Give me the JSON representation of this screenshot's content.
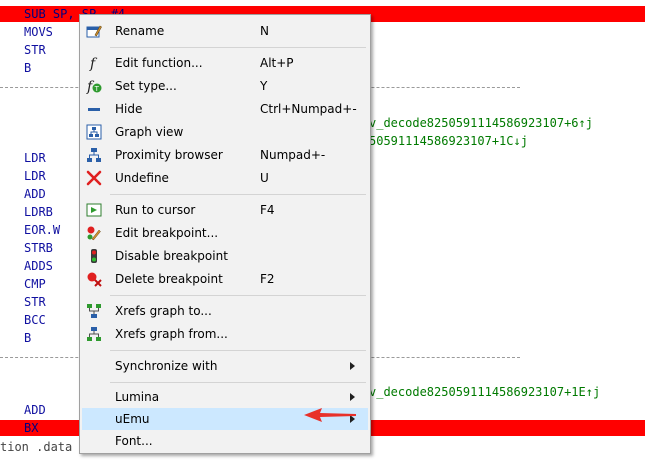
{
  "disasm": {
    "top_line": "SUB  SP, SP, #4",
    "mnemonics_a": [
      "MOVS",
      "STR",
      "B"
    ],
    "mnemonics_b": [
      "LDR",
      "LDR",
      "ADD",
      "LDRB",
      "EOR.W",
      "STRB",
      "ADDS",
      "CMP",
      "STR",
      "BCC",
      "B"
    ],
    "mnemonics_c": [
      "ADD",
      "BX"
    ],
    "xref_1": "v_decode8250591114586923107+6↑j",
    "xref_2": "50591114586923107+1C↓j",
    "xref_3": "v_decode8250591114586923107+1E↑j",
    "status": "tion .data"
  },
  "menu": {
    "items": [
      {
        "label": "Rename",
        "shortcut": "N",
        "icon": "rename-icon"
      },
      {
        "label": "Edit function...",
        "shortcut": "Alt+P",
        "icon": "function-icon"
      },
      {
        "label": "Set type...",
        "shortcut": "Y",
        "icon": "set-type-icon"
      },
      {
        "label": "Hide",
        "shortcut": "Ctrl+Numpad+-",
        "icon": "hide-icon"
      },
      {
        "label": "Graph view",
        "shortcut": "",
        "icon": "graph-view-icon"
      },
      {
        "label": "Proximity browser",
        "shortcut": "Numpad+-",
        "icon": "proximity-icon"
      },
      {
        "label": "Undefine",
        "shortcut": "U",
        "icon": "undefine-icon"
      },
      {
        "label": "Run to cursor",
        "shortcut": "F4",
        "icon": "run-to-cursor-icon"
      },
      {
        "label": "Edit breakpoint...",
        "shortcut": "",
        "icon": "edit-breakpoint-icon"
      },
      {
        "label": "Disable breakpoint",
        "shortcut": "",
        "icon": "disable-breakpoint-icon"
      },
      {
        "label": "Delete breakpoint",
        "shortcut": "F2",
        "icon": "delete-breakpoint-icon"
      },
      {
        "label": "Xrefs graph to...",
        "shortcut": "",
        "icon": "xrefs-to-icon"
      },
      {
        "label": "Xrefs graph from...",
        "shortcut": "",
        "icon": "xrefs-from-icon"
      },
      {
        "label": "Synchronize with",
        "shortcut": "",
        "icon": ""
      },
      {
        "label": "Lumina",
        "shortcut": "",
        "icon": ""
      },
      {
        "label": "uEmu",
        "shortcut": "",
        "icon": ""
      },
      {
        "label": "Font...",
        "shortcut": "",
        "icon": ""
      }
    ]
  },
  "colors": {
    "highlight_row": "#ff0000",
    "menu_selected": "#cce8ff",
    "annotation_arrow": "#e8302a"
  }
}
